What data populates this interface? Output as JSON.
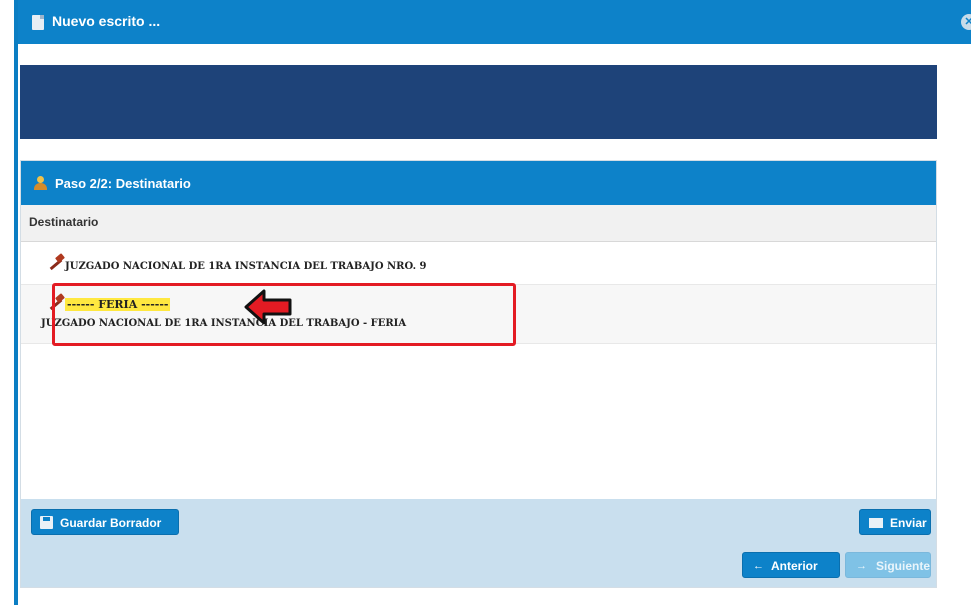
{
  "window": {
    "title": "Nuevo escrito ..."
  },
  "panel": {
    "header": "Paso 2/2: Destinatario",
    "column_header": "Destinatario",
    "rows": [
      {
        "tag": "",
        "name": "JUZGADO NACIONAL DE 1RA INSTANCIA DEL TRABAJO NRO. 9"
      },
      {
        "tag": "------ FERIA ------",
        "name": "JUZGADO NACIONAL DE 1RA INSTANCIA DEL TRABAJO - FERIA"
      }
    ]
  },
  "buttons": {
    "save_draft": "Guardar Borrador",
    "send": "Enviar",
    "previous": "Anterior",
    "next": "Siguiente"
  },
  "colors": {
    "titlebar": "#0d82c9",
    "banner": "#1e4379",
    "footer": "#c9dfee",
    "highlight": "#e31b23",
    "feria_tag": "#ffe840"
  }
}
